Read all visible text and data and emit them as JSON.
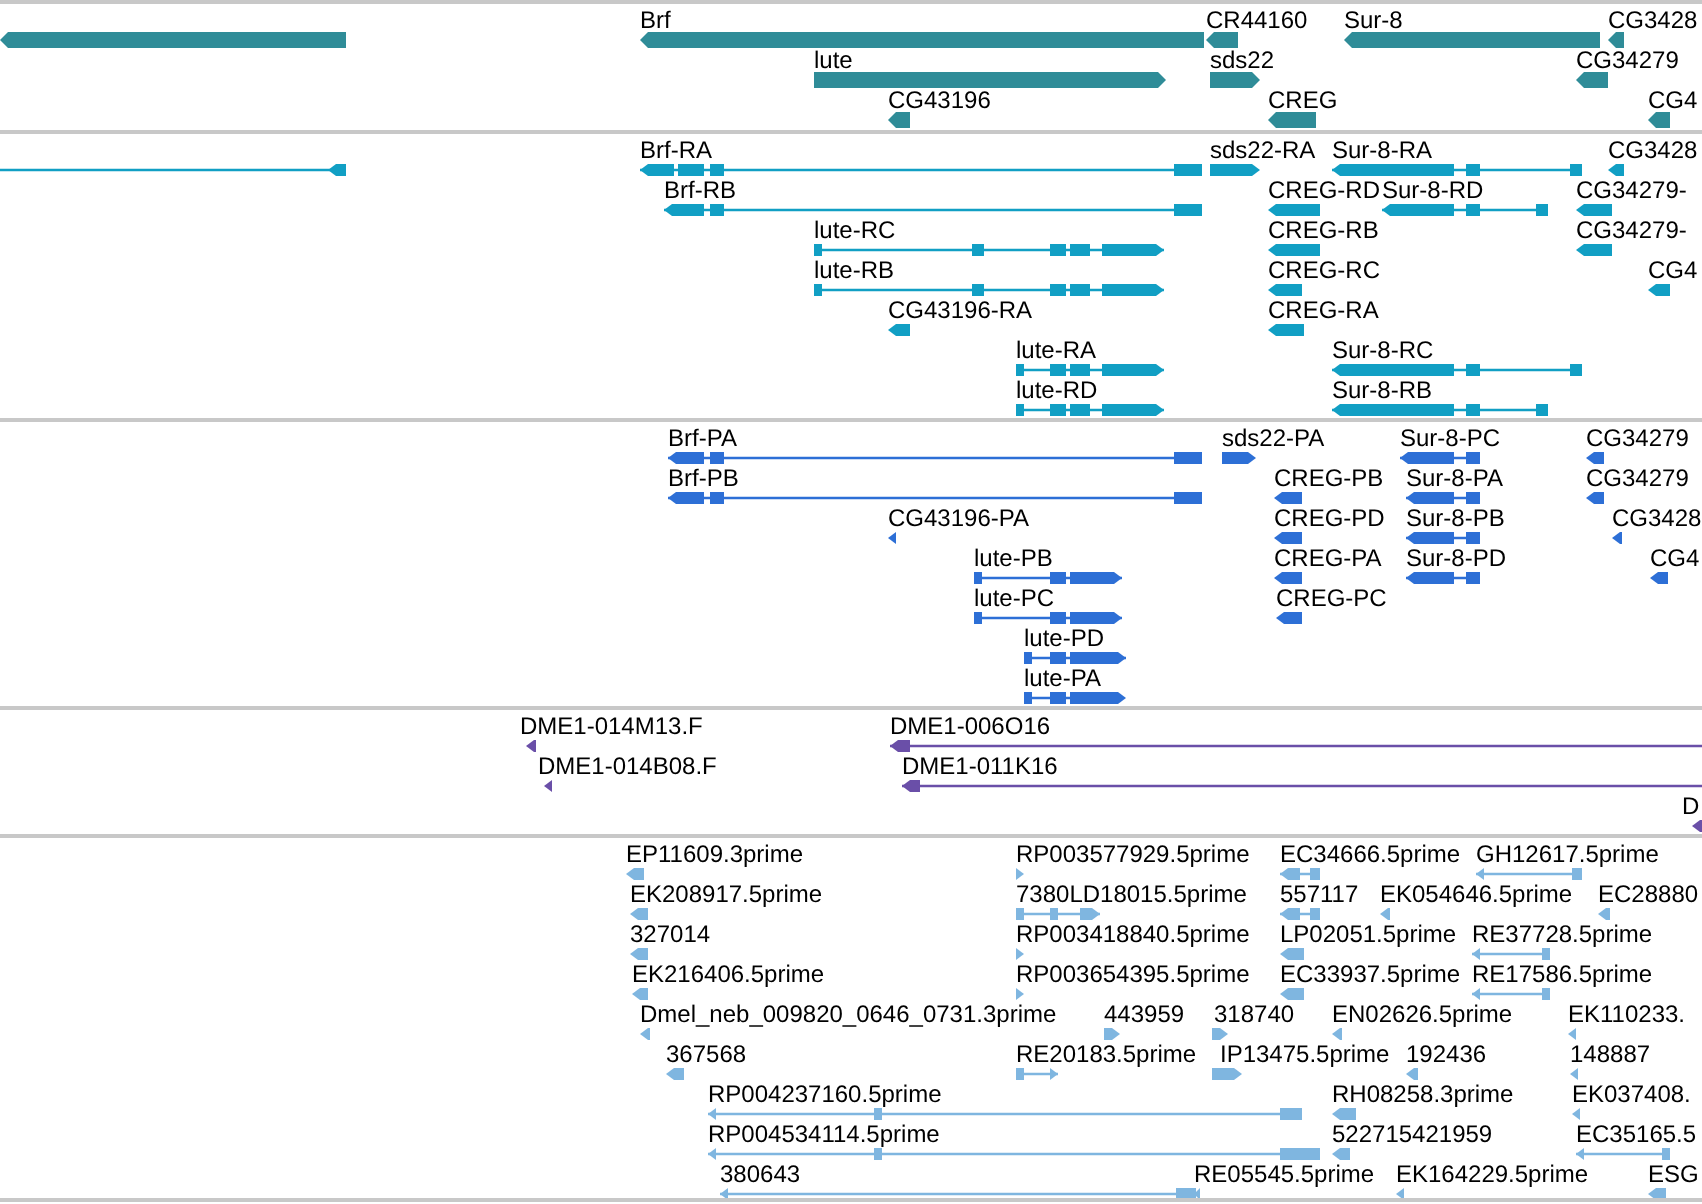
{
  "tracks": [
    {
      "kind": "gene",
      "color": "#2f8c98",
      "features": [
        {
          "reverse": true
        },
        {
          "label": "Brf",
          "reverse": true
        },
        {
          "label": "CR44160",
          "reverse": true
        },
        {
          "label": "Sur-8",
          "reverse": true
        },
        {
          "label": "CG3428",
          "reverse": true
        },
        {
          "label": "lute",
          "reverse": false
        },
        {
          "label": "sds22",
          "reverse": false
        },
        {
          "label": "CG34279",
          "reverse": true
        },
        {
          "label": "CG43196",
          "reverse": true
        },
        {
          "label": "CREG",
          "reverse": true
        },
        {
          "label": "CG4",
          "reverse": true
        }
      ]
    },
    {
      "kind": "transcript",
      "color": "#119fc4",
      "features": [
        {
          "reverse": true
        },
        {
          "label": "Brf-RA",
          "reverse": true
        },
        {
          "label": "sds22-RA",
          "reverse": false
        },
        {
          "label": "Sur-8-RA",
          "reverse": true
        },
        {
          "label": "CG3428",
          "reverse": true
        },
        {
          "label": "Brf-RB",
          "reverse": true
        },
        {
          "label": "CREG-RD",
          "reverse": true
        },
        {
          "label": "Sur-8-RD",
          "reverse": true
        },
        {
          "label": "CG34279-",
          "reverse": true
        },
        {
          "label": "lute-RC",
          "reverse": false
        },
        {
          "label": "CREG-RB",
          "reverse": true
        },
        {
          "label": "CG34279-",
          "reverse": true
        },
        {
          "label": "lute-RB",
          "reverse": false
        },
        {
          "label": "CREG-RC",
          "reverse": true
        },
        {
          "label": "CG4",
          "reverse": true
        },
        {
          "label": "CG43196-RA",
          "reverse": true
        },
        {
          "label": "CREG-RA",
          "reverse": true
        },
        {
          "label": "lute-RA",
          "reverse": false
        },
        {
          "label": "Sur-8-RC",
          "reverse": true
        },
        {
          "label": "lute-RD",
          "reverse": false
        },
        {
          "label": "Sur-8-RB",
          "reverse": true
        }
      ]
    },
    {
      "kind": "protein",
      "color": "#2d6fd6",
      "features": [
        {
          "label": "Brf-PA",
          "reverse": true
        },
        {
          "label": "sds22-PA",
          "reverse": false
        },
        {
          "label": "Sur-8-PC",
          "reverse": true
        },
        {
          "label": "CG34279",
          "reverse": true
        },
        {
          "label": "Brf-PB",
          "reverse": true
        },
        {
          "label": "CREG-PB",
          "reverse": true
        },
        {
          "label": "Sur-8-PA",
          "reverse": true
        },
        {
          "label": "CG34279",
          "reverse": true
        },
        {
          "label": "CG43196-PA",
          "reverse": true
        },
        {
          "label": "CREG-PD",
          "reverse": true
        },
        {
          "label": "Sur-8-PB",
          "reverse": true
        },
        {
          "label": "CG3428",
          "reverse": true
        },
        {
          "label": "lute-PB",
          "reverse": false
        },
        {
          "label": "CREG-PA",
          "reverse": true
        },
        {
          "label": "Sur-8-PD",
          "reverse": true
        },
        {
          "label": "CG4",
          "reverse": true
        },
        {
          "label": "lute-PC",
          "reverse": false
        },
        {
          "label": "CREG-PC",
          "reverse": true
        },
        {
          "label": "lute-PD",
          "reverse": false
        },
        {
          "label": "lute-PA",
          "reverse": false
        }
      ]
    },
    {
      "kind": "clone",
      "color": "#6a4fa8",
      "features": [
        {
          "label": "DME1-014M13.F",
          "reverse": true
        },
        {
          "label": "DME1-006O16",
          "reverse": true
        },
        {
          "label": "DME1-014B08.F",
          "reverse": true
        },
        {
          "label": "DME1-011K16",
          "reverse": true
        },
        {
          "label": "D",
          "reverse": true
        }
      ]
    },
    {
      "kind": "est",
      "color": "#7fb6e0",
      "features": [
        {
          "label": "EP11609.3prime",
          "reverse": true
        },
        {
          "label": "RP003577929.5prime",
          "reverse": false
        },
        {
          "label": "EC34666.5prime",
          "reverse": true
        },
        {
          "label": "GH12617.5prime",
          "reverse": true
        },
        {
          "label": "EK208917.5prime",
          "reverse": true
        },
        {
          "label": "7380LD18015.5prime",
          "reverse": false
        },
        {
          "label": "557117",
          "reverse": true
        },
        {
          "label": "EK054646.5prime",
          "reverse": true
        },
        {
          "label": "EC28880",
          "reverse": true
        },
        {
          "label": "327014",
          "reverse": true
        },
        {
          "label": "RP003418840.5prime",
          "reverse": false
        },
        {
          "label": "LP02051.5prime",
          "reverse": true
        },
        {
          "label": "RE37728.5prime",
          "reverse": true
        },
        {
          "label": "EK216406.5prime",
          "reverse": true
        },
        {
          "label": "RP003654395.5prime",
          "reverse": false
        },
        {
          "label": "EC33937.5prime",
          "reverse": true
        },
        {
          "label": "RE17586.5prime",
          "reverse": true
        },
        {
          "label": "Dmel_neb_009820_0646_0731.3prime",
          "reverse": true
        },
        {
          "label": "443959",
          "reverse": false
        },
        {
          "label": "318740",
          "reverse": false
        },
        {
          "label": "EN02626.5prime",
          "reverse": true
        },
        {
          "label": "EK110233.",
          "reverse": true
        },
        {
          "label": "367568",
          "reverse": true
        },
        {
          "label": "RE20183.5prime",
          "reverse": false
        },
        {
          "label": "IP13475.5prime",
          "reverse": false
        },
        {
          "label": "192436",
          "reverse": true
        },
        {
          "label": "148887",
          "reverse": true
        },
        {
          "label": "RP004237160.5prime",
          "reverse": true
        },
        {
          "label": "RH08258.3prime",
          "reverse": true
        },
        {
          "label": "EK037408.",
          "reverse": true
        },
        {
          "label": "RP004534114.5prime",
          "reverse": true
        },
        {
          "label": "522715421959",
          "reverse": true
        },
        {
          "label": "EC35165.5",
          "reverse": true
        },
        {
          "label": "380643",
          "reverse": true
        },
        {
          "label": "RE05545.5prime",
          "reverse": true
        },
        {
          "label": "EK164229.5prime",
          "reverse": true
        },
        {
          "label": "ESG",
          "reverse": true
        }
      ]
    }
  ]
}
